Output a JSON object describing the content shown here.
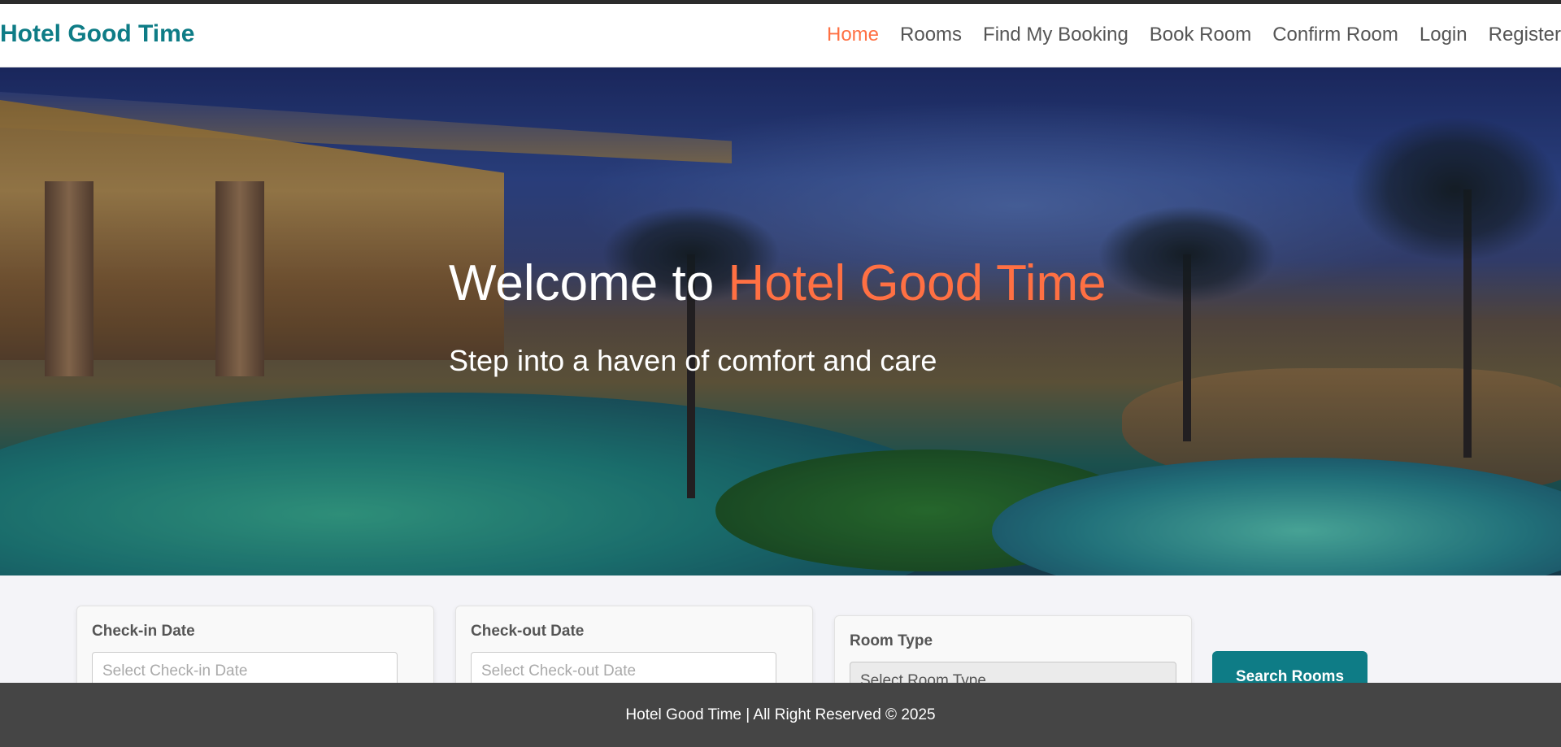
{
  "navbar": {
    "brand": "Hotel Good Time",
    "links": [
      {
        "label": "Home",
        "active": true
      },
      {
        "label": "Rooms",
        "active": false
      },
      {
        "label": "Find My Booking",
        "active": false
      },
      {
        "label": "Book Room",
        "active": false
      },
      {
        "label": "Confirm Room",
        "active": false
      },
      {
        "label": "Login",
        "active": false
      },
      {
        "label": "Register",
        "active": false
      }
    ]
  },
  "hero": {
    "title_prefix": "Welcome to ",
    "title_accent": "Hotel Good Time",
    "subtitle": "Step into a haven of comfort and care"
  },
  "search": {
    "checkin": {
      "label": "Check-in Date",
      "placeholder": "Select Check-in Date"
    },
    "checkout": {
      "label": "Check-out Date",
      "placeholder": "Select Check-out Date"
    },
    "room_type": {
      "label": "Room Type",
      "selected": "Select Room Type"
    },
    "button_label": "Search Rooms"
  },
  "footer": {
    "text": "Hotel Good Time | All Right Reserved © 2025"
  },
  "colors": {
    "brand": "#0e7c86",
    "accent": "#ff7043",
    "footer_bg": "#454545"
  }
}
